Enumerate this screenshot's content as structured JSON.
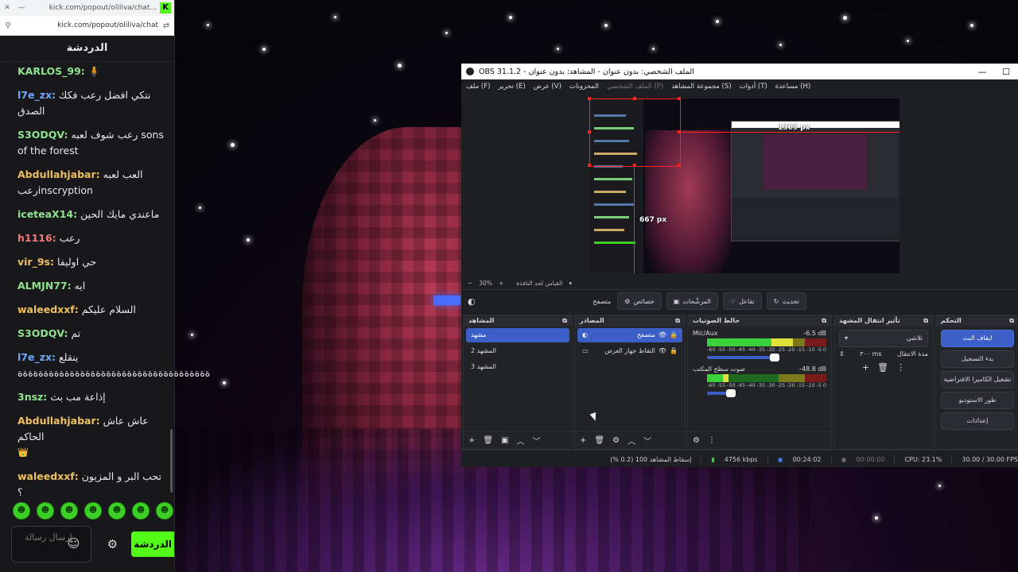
{
  "browser": {
    "tab_url": "kick.com/popout/oliliva/chat...",
    "url": "kick.com/popout/oliliva/chat",
    "kick_logo": "K"
  },
  "chat": {
    "title": "الدردشة",
    "messages": [
      {
        "user": "KARLOS_99:",
        "text": "",
        "color": "#8fe38f"
      },
      {
        "user": "l7e_zx:",
        "text": "نتكي افضل رعب فكك الصدق",
        "color": "#6fa8ff"
      },
      {
        "user": "S3ODQV:",
        "text": "رعب شوف لعبه sons of the forest",
        "color": "#8fe38f"
      },
      {
        "user": "Abdullahjabar:",
        "text": "العب لعبه رعبinscryption",
        "color": "#f0c060"
      },
      {
        "user": "iceteaX14:",
        "text": "ماعندي مايك الحين",
        "color": "#8fe38f"
      },
      {
        "user": "h1116:",
        "text": "رعب",
        "color": "#f07a7a"
      },
      {
        "user": "vir_9s:",
        "text": "حي اوليفا",
        "color": "#f0c060"
      },
      {
        "user": "ALMJN77:",
        "text": "ايه",
        "color": "#8fe38f"
      },
      {
        "user": "waleedxxf:",
        "text": "السلام عليكم",
        "color": "#f0c060"
      },
      {
        "user": "S3ODQV:",
        "text": "تم",
        "color": "#8fe38f"
      },
      {
        "user": "l7e_zx:",
        "text": "ينقلع ةةةةةةةةةةةةةةةةةةةةةةةةةةةةةةةةةةةةة",
        "color": "#6fa8ff"
      },
      {
        "user": "3nsz:",
        "text": "إذاعة مب بث",
        "color": "#8fe38f"
      },
      {
        "user": "Abdullahjabar:",
        "text": "عاش عاش الحاكم",
        "color": "#f0c060"
      },
      {
        "user": "waleedxxf:",
        "text": "تحب البر و المزيون ؟",
        "color": "#f0c060"
      }
    ],
    "input_placeholder": "إرسال رسالة",
    "send_label": "الدردشة"
  },
  "obs": {
    "title": "OBS 31.1.2 - الملف الشخصي: بدون عنوان - المشاهد: بدون عنوان",
    "menu": [
      "ملف (F)",
      "تحرير (E)",
      "عرض (V)",
      "المحزونات",
      "الملف الشخصي (P)",
      "مجموعة المشاهد (S)",
      "أدوات (T)",
      "مساعدة (H)"
    ],
    "zoom": "30%",
    "zoom_label": "القياس لحد النافذة",
    "preview_px_h": "1369 px",
    "preview_px_v": "667 px",
    "source_toolbar": {
      "selected": "متصفح",
      "props": "خصائص",
      "filters": "المرشّحات",
      "interact": "تفاعل",
      "refresh": "تحديث"
    },
    "scenes": {
      "title": "المشاهد",
      "items": [
        "مشهد",
        "المشهد 2",
        "المشهد 3"
      ]
    },
    "sources": {
      "title": "المصادر",
      "items": [
        "متصفح",
        "التقاط جهاز العرض"
      ]
    },
    "mixer": {
      "title": "خالط الصوتيات",
      "channels": [
        {
          "name": "Mic/Aux",
          "db": "-6.5 dB",
          "level": 0.72,
          "volume": 0.85
        },
        {
          "name": "صوت سطح المكتب",
          "db": "-48.8 dB",
          "level": 0.18,
          "volume": 0.3
        }
      ],
      "scale": [
        "-60",
        "-55",
        "-50",
        "-45",
        "-40",
        "-35",
        "-30",
        "-25",
        "-20",
        "-15",
        "-10",
        "-5",
        "0"
      ]
    },
    "transitions": {
      "title": "تأثير انتقال المشهد",
      "type": "تلاشي",
      "duration_label": "مدة الانتقال",
      "duration": "٣٠٠ ms"
    },
    "controls": {
      "title": "التحكم",
      "buttons": [
        "ايقاف البث",
        "بدء التسجيل",
        "تشغيل الكاميرا الافتراضية",
        "طور الاستوديو",
        "إعدادات"
      ]
    },
    "status": {
      "dropped": "إسقاط المشاهد 100 (0.2 %)",
      "kbps": "4756 kbps",
      "stream_time": "00:24:02",
      "rec_time": "00:00:00",
      "cpu": "CPU: 23.1%",
      "fps": "30.00 / 30.00 FPS"
    }
  }
}
